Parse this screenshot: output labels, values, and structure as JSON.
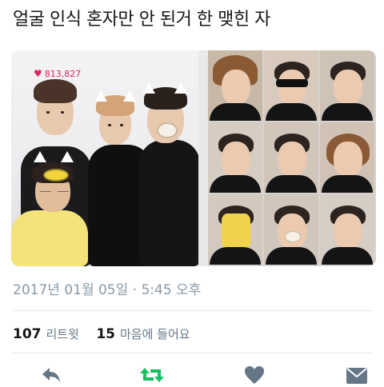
{
  "tweet": {
    "text": "얼굴 인식 혼자만 안 된거 한 맺힌 자",
    "timestamp": "2017년 01월 05일 · 5:45 오후"
  },
  "media": {
    "left_photo_like_count": "813,827"
  },
  "stats": {
    "retweets_count": "107",
    "retweets_label": "리트윗",
    "likes_count": "15",
    "likes_label": "마음에 들어요"
  },
  "actions": [
    {
      "icon": "reply-icon"
    },
    {
      "icon": "retweet-icon",
      "color": "#17bf63"
    },
    {
      "icon": "heart-icon"
    },
    {
      "icon": "message-icon"
    }
  ],
  "colors": {
    "text": "#14171a",
    "muted": "#8899a6",
    "divider": "#e1e8ed",
    "retweet_green": "#17bf63",
    "like_pink": "#e0245e"
  }
}
